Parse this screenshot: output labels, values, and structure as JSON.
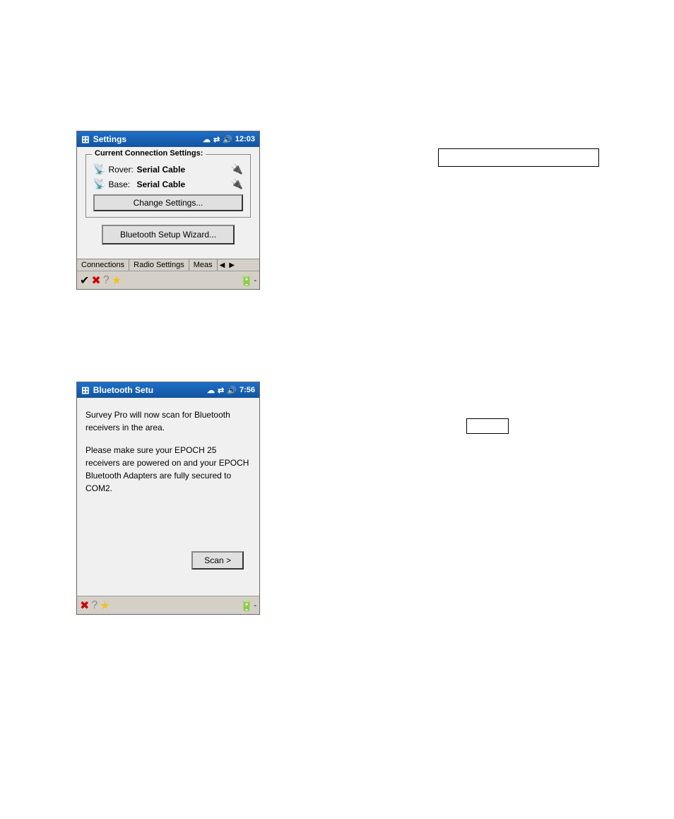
{
  "window1": {
    "titlebar": {
      "icon": "⊞",
      "title": "Settings",
      "time": "12:03",
      "icons": [
        "☁",
        "⇄",
        "🔊"
      ]
    },
    "connection_group_label": "Current Connection Settings:",
    "rover_label": "Rover:",
    "rover_value": "Serial Cable",
    "base_label": "Base:",
    "base_value": "Serial Cable",
    "change_button": "Change Settings...",
    "bluetooth_button": "Bluetooth Setup Wizard...",
    "tabs": [
      "Connections",
      "Radio Settings",
      "Meas"
    ],
    "toolbar_icons": [
      "✔",
      "✖",
      "?",
      "★"
    ],
    "battery": "🔋"
  },
  "window2": {
    "titlebar": {
      "icon": "⊞",
      "title": "Bluetooth Setu",
      "time": "7:56",
      "icons": [
        "☁",
        "⇄",
        "🔊"
      ]
    },
    "text1": "Survey Pro will now scan for Bluetooth receivers in the area.",
    "text2": "Please make sure your EPOCH 25 receivers are powered on and your EPOCH Bluetooth Adapters are fully secured to COM2.",
    "scan_button": "Scan >",
    "toolbar_icons": [
      "✖",
      "?",
      "★"
    ],
    "battery": "🔋"
  },
  "annotation1": "",
  "annotation2": ""
}
